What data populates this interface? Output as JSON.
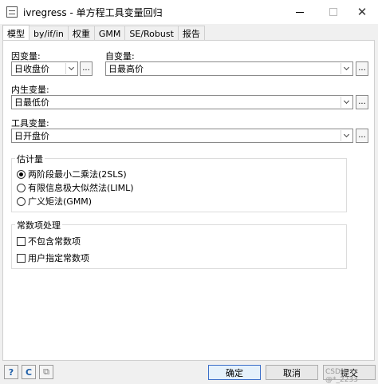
{
  "window": {
    "title": "ivregress - 单方程工具变量回归",
    "minimize_glyph": "",
    "close_glyph": "✕"
  },
  "tabs": [
    {
      "label": "模型",
      "active": true
    },
    {
      "label": "by/if/in",
      "active": false
    },
    {
      "label": "权重",
      "active": false
    },
    {
      "label": "GMM",
      "active": false
    },
    {
      "label": "SE/Robust",
      "active": false
    },
    {
      "label": "报告",
      "active": false
    }
  ],
  "model": {
    "dependent": {
      "label": "因变量:",
      "value": "日收盘价"
    },
    "independent": {
      "label": "自变量:",
      "value": "日最高价"
    },
    "endogenous": {
      "label": "内生变量:",
      "value": "日最低价"
    },
    "instruments": {
      "label": "工具变量:",
      "value": "日开盘价"
    },
    "browse_label": "...",
    "estimator": {
      "title": "估计量",
      "options": [
        {
          "label": "两阶段最小二乘法(2SLS)",
          "selected": true
        },
        {
          "label": "有限信息极大似然法(LIML)",
          "selected": false
        },
        {
          "label": "广义矩法(GMM)",
          "selected": false
        }
      ]
    },
    "constant": {
      "title": "常数项处理",
      "options": [
        {
          "label": "不包含常数项",
          "checked": false
        },
        {
          "label": "用户指定常数项",
          "checked": false
        }
      ]
    }
  },
  "footer": {
    "help_glyph": "?",
    "reset_glyph": "C",
    "copy_glyph": "⧉",
    "ok_label": "确定",
    "cancel_label": "取消",
    "submit_label": "提交",
    "watermark": "CSDN @*_2233"
  },
  "colors": {
    "accent": "#3c6fc9",
    "panel_bg": "#ffffff",
    "window_bg": "#f0f0f0"
  }
}
